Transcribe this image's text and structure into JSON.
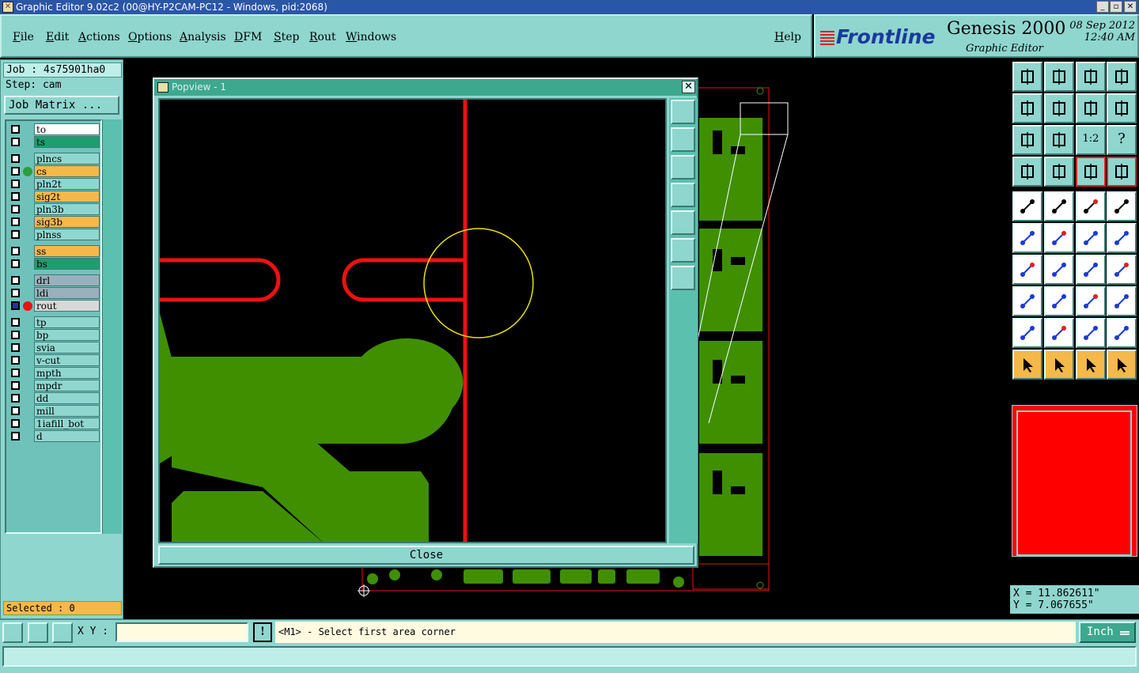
{
  "window": {
    "title": "Graphic Editor 9.02c2 (00@HY-P2CAM-PC12 - Windows, pid:2068)",
    "min": "_",
    "max": "▫",
    "close": "✕"
  },
  "menu": {
    "items": [
      "File",
      "Edit",
      "Actions",
      "Options",
      "Analysis",
      "DFM",
      "Step",
      "Rout",
      "Windows"
    ],
    "help": "Help"
  },
  "brand": {
    "logo": "Frontline",
    "product": "Genesis 2000",
    "subtitle": "Graphic Editor",
    "date": "08  Sep  2012",
    "time": "12:40  AM"
  },
  "job": {
    "job_label": "Job : 4s75901ha0",
    "step_label": "Step: cam",
    "matrix_button": "Job Matrix ..."
  },
  "layers": [
    {
      "name": "to",
      "color": "#ffffff",
      "active": false
    },
    {
      "name": "ts",
      "color": "#1e9e6e",
      "active": false
    },
    {
      "name": "plncs",
      "color": "#8fd6cf",
      "active": false
    },
    {
      "name": "cs",
      "color": "#f5b84a",
      "active": true,
      "dot": "#2a9e3a"
    },
    {
      "name": "pln2t",
      "color": "#8fd6cf",
      "active": false
    },
    {
      "name": "sig2t",
      "color": "#f5b84a",
      "active": false
    },
    {
      "name": "pln3b",
      "color": "#8fd6cf",
      "active": false
    },
    {
      "name": "sig3b",
      "color": "#f5b84a",
      "active": false
    },
    {
      "name": "plnss",
      "color": "#8fd6cf",
      "active": false
    },
    {
      "name": "ss",
      "color": "#f5b84a",
      "active": false
    },
    {
      "name": "bs",
      "color": "#1e9e6e",
      "active": false
    },
    {
      "name": "drl",
      "color": "#9ab0bc",
      "active": false
    },
    {
      "name": "ldi",
      "color": "#9ab0bc",
      "active": false
    },
    {
      "name": "rout",
      "color": "#d8d8d8",
      "active": true,
      "dot": "#ee1111"
    },
    {
      "name": "tp",
      "color": "#8fd6cf",
      "active": false
    },
    {
      "name": "bp",
      "color": "#8fd6cf",
      "active": false
    },
    {
      "name": "svia",
      "color": "#8fd6cf",
      "active": false
    },
    {
      "name": "v-cut",
      "color": "#8fd6cf",
      "active": false
    },
    {
      "name": "mpth",
      "color": "#8fd6cf",
      "active": false
    },
    {
      "name": "mpdr",
      "color": "#8fd6cf",
      "active": false
    },
    {
      "name": "dd",
      "color": "#8fd6cf",
      "active": false
    },
    {
      "name": "mill",
      "color": "#8fd6cf",
      "active": false
    },
    {
      "name": "1iafill_bot",
      "color": "#8fd6cf",
      "active": false
    },
    {
      "name": "d",
      "color": "#8fd6cf",
      "active": false
    }
  ],
  "selected_label": "Selected : 0",
  "popview": {
    "title": "Popview - 1",
    "close_x": "✕",
    "close_button": "Close"
  },
  "toolbar": {
    "icons": [
      "zoom-home-icon",
      "zoom-fit-icon",
      "home-icon",
      "split-window-icon",
      "pan-left-icon",
      "pan-right-icon",
      "rotate-icon",
      "flip-icon",
      "zoom-in-icon",
      "zoom-out-icon",
      "one-to-one-icon",
      "help-icon",
      "tools-icon",
      "grid-icon",
      "layer-colors-icon",
      "layer-settings-icon",
      "snap-icon",
      "measure-icon",
      "ruler-icon",
      "pad-icon",
      "connect-icon",
      "cross-icon",
      "line-add-icon",
      "line-move-icon",
      "angle-icon",
      "slash-icon",
      "arc-icon",
      "text-icon",
      "move-pad-icon",
      "line-cut-icon",
      "dimension-icon",
      "cluster-icon",
      "triangle-icon",
      "triangle-select-icon",
      "triangle-area-icon",
      "triangle-ref-icon",
      "select-arrow-icon",
      "select-box-icon",
      "select-touch-icon",
      "select-net-icon"
    ],
    "onetoone_text": "1:2",
    "help_text": "?"
  },
  "coords": {
    "x": "X = 11.862611\"",
    "y": "Y = 7.067655\""
  },
  "bottom": {
    "xy_label": "X Y :",
    "xy_value": "",
    "excl": "!",
    "prompt": "<M1> - Select first area corner",
    "unit": "Inch"
  },
  "colors": {
    "panel": "#8fd6cf",
    "copper": "#3f8f00",
    "rout": "#ee1111",
    "highlight": "#f5b84a"
  }
}
